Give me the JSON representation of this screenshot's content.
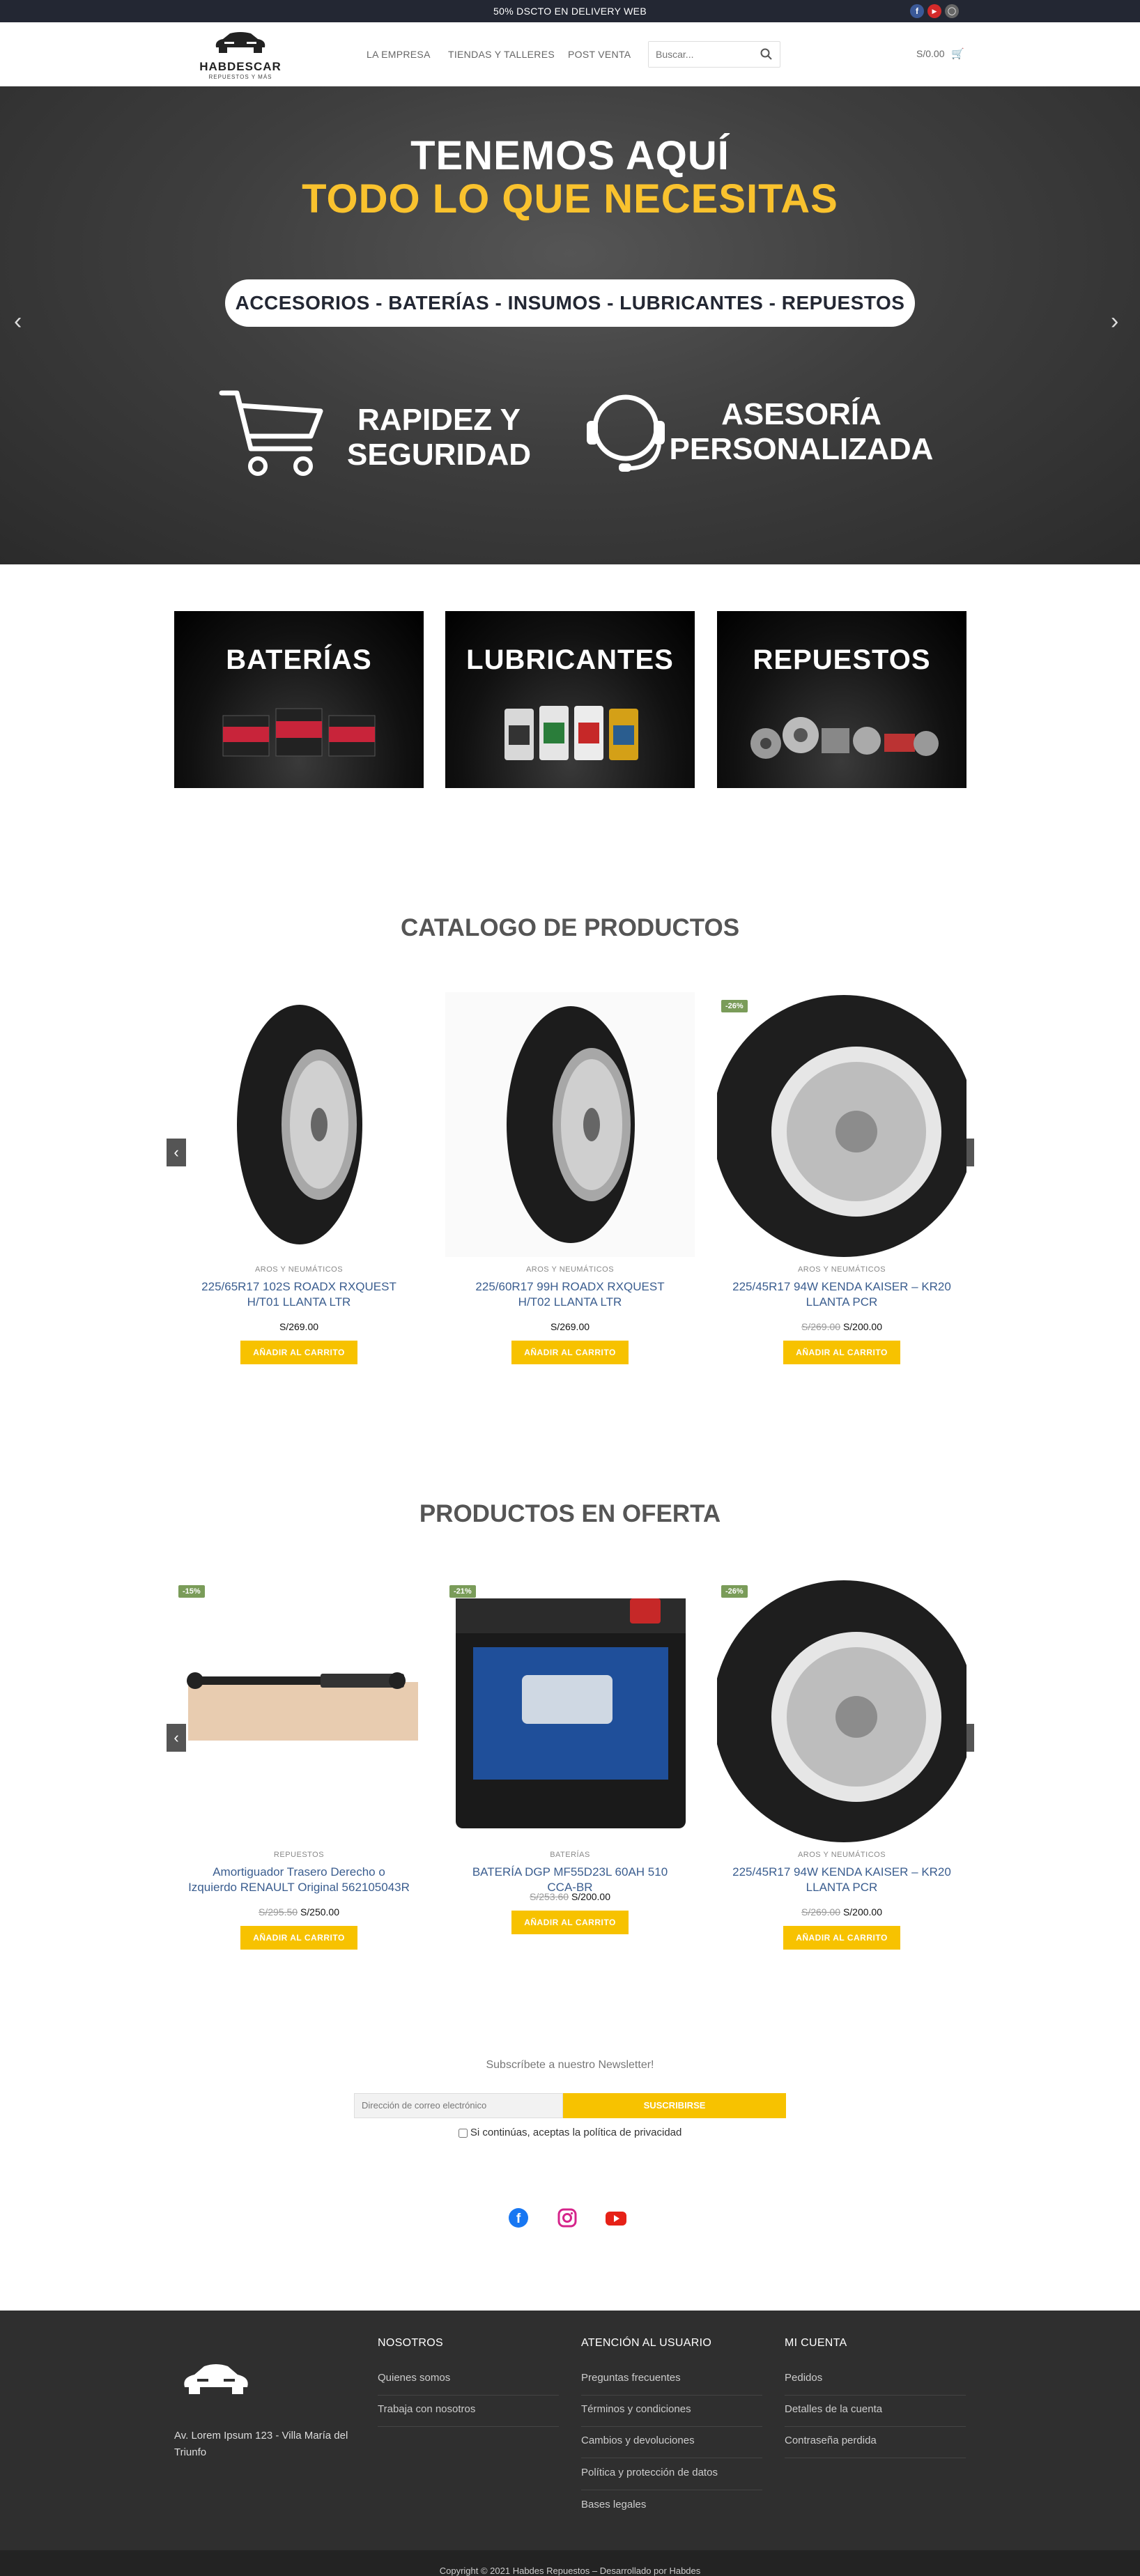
{
  "topbar": {
    "promo": "50% DSCTO EN DELIVERY WEB",
    "social": [
      "facebook-icon",
      "youtube-icon",
      "instagram-icon"
    ],
    "colors": {
      "bg": "#232733"
    }
  },
  "header": {
    "logo": {
      "name": "HABDESCAR",
      "tagline": "REPUESTOS Y MÁS"
    },
    "nav": [
      "LA EMPRESA",
      "TIENDAS Y TALLERES",
      "POST VENTA"
    ],
    "search_placeholder": "Buscar...",
    "cart_total": "S/0.00"
  },
  "hero": {
    "line1": "TENEMOS AQUÍ",
    "line2": "TODO LO QUE NECESITAS",
    "pill": "ACCESORIOS - BATERÍAS - INSUMOS - LUBRICANTES - REPUESTOS",
    "feature1": [
      "RAPIDEZ Y",
      "SEGURIDAD"
    ],
    "feature2": [
      "ASESORÍA",
      "PERSONALIZADA"
    ],
    "colors": {
      "accent": "#f9c22e"
    }
  },
  "categories": [
    "BATERÍAS",
    "LUBRICANTES",
    "REPUESTOS"
  ],
  "catalog": {
    "title": "CATALOGO DE PRODUCTOS",
    "products": [
      {
        "category": "AROS Y NEUMÁTICOS",
        "name": "225/65R17 102S ROADX RXQUEST H/T01 LLANTA LTR",
        "old_price": "",
        "price": "S/269.00",
        "badge": "",
        "button": "AÑADIR AL CARRITO"
      },
      {
        "category": "AROS Y NEUMÁTICOS",
        "name": "225/60R17 99H ROADX RXQUEST H/T02 LLANTA LTR",
        "old_price": "",
        "price": "S/269.00",
        "badge": "",
        "button": "AÑADIR AL CARRITO"
      },
      {
        "category": "AROS Y NEUMÁTICOS",
        "name": "225/45R17 94W KENDA KAISER – KR20 LLANTA PCR",
        "old_price": "S/269.00",
        "price": "S/200.00",
        "badge": "-26%",
        "button": "AÑADIR AL CARRITO"
      }
    ]
  },
  "offers": {
    "title": "PRODUCTOS EN OFERTA",
    "products": [
      {
        "category": "REPUESTOS",
        "name": "Amortiguador Trasero Derecho o Izquierdo RENAULT Original 562105043R",
        "old_price": "S/295.50",
        "price": "S/250.00",
        "badge": "-15%",
        "button": "AÑADIR AL CARRITO"
      },
      {
        "category": "BATERÍAS",
        "name": "BATERÍA DGP MF55D23L 60AH 510 CCA-BR",
        "old_price": "S/253.60",
        "price": "S/200.00",
        "badge": "-21%",
        "button": "AÑADIR AL CARRITO"
      },
      {
        "category": "AROS Y NEUMÁTICOS",
        "name": "225/45R17 94W KENDA KAISER – KR20 LLANTA PCR",
        "old_price": "S/269.00",
        "price": "S/200.00",
        "badge": "-26%",
        "button": "AÑADIR AL CARRITO"
      }
    ]
  },
  "newsletter": {
    "title": "Subscríbete a nuestro Newsletter!",
    "email_placeholder": "Dirección de correo electrónico",
    "button": "SUSCRIBIRSE",
    "consent": "Si continúas, aceptas la política de privacidad"
  },
  "social_row": [
    "facebook-icon",
    "instagram-icon",
    "youtube-icon"
  ],
  "footer": {
    "address": "Av. Lorem Ipsum 123 - Villa María del Triunfo",
    "col1": {
      "title": "NOSOTROS",
      "links": [
        "Quienes somos",
        "Trabaja con nosotros"
      ]
    },
    "col2": {
      "title": "ATENCIÓN AL USUARIO",
      "links": [
        "Preguntas frecuentes",
        "Términos y condiciones",
        "Cambios y devoluciones",
        "Política y protección de datos",
        "Bases legales"
      ]
    },
    "col3": {
      "title": "MI CUENTA",
      "links": [
        "Pedidos",
        "Detalles de la cuenta",
        "Contraseña perdida"
      ]
    },
    "copyright": "Copyright © 2021 Habdes Repuestos – Desarrollado por Habdes"
  }
}
